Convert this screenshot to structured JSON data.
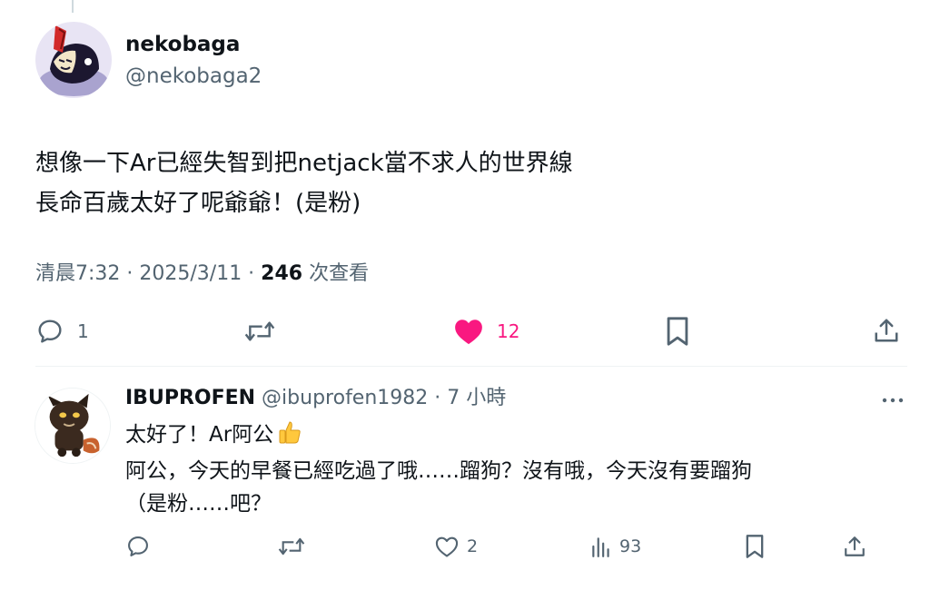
{
  "main_tweet": {
    "display_name": "nekobaga",
    "handle": "@nekobaga2",
    "text_lines": [
      "想像一下Ar已經失智到把netjack當不求人的世界線",
      "長命百歲太好了呢爺爺！(是粉)"
    ],
    "time": "清晨7:32 · 2025/3/11 · ",
    "views": "246",
    "views_label": " 次查看",
    "actions": {
      "replies": "1",
      "retweets": "",
      "likes": "12"
    }
  },
  "reply_tweet": {
    "display_name": "IBUPROFEN",
    "handle_time": " @ibuprofen1982 · 7 小時",
    "text_line1": "太好了！Ar阿公",
    "text_line2": "阿公，今天的早餐已經吃過了哦……蹓狗？沒有哦，今天沒有要蹓狗",
    "text_line3": "（是粉……吧？",
    "actions": {
      "replies": "",
      "retweets": "",
      "likes": "2",
      "views": "93"
    }
  },
  "colors": {
    "text": "#0f1419",
    "secondary": "#536471",
    "like": "#f91880",
    "divider": "#eff3f4"
  }
}
